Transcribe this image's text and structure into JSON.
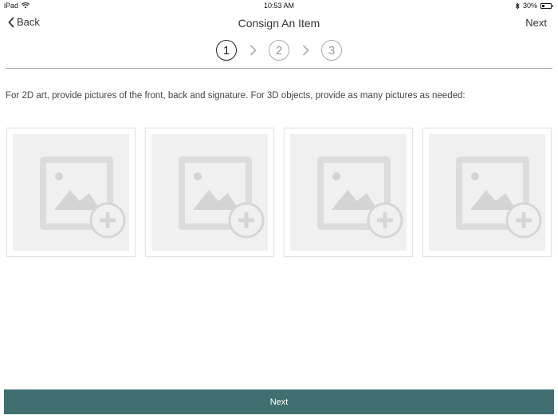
{
  "status_bar": {
    "device": "iPad",
    "time": "10:53 AM",
    "battery": "30%",
    "battery_level": 0.3
  },
  "nav": {
    "back_label": "Back",
    "title": "Consign An Item",
    "next_label": "Next"
  },
  "stepper": {
    "steps": [
      "1",
      "2",
      "3"
    ],
    "active_step": 1
  },
  "instructions": "For 2D art, provide pictures of the front, back and signature.  For 3D objects, provide as many pictures as needed:",
  "photo_slots": [
    {
      "icon": "add-photo-icon"
    },
    {
      "icon": "add-photo-icon"
    },
    {
      "icon": "add-photo-icon"
    },
    {
      "icon": "add-photo-icon"
    }
  ],
  "footer": {
    "next_label": "Next",
    "color": "#3f6f71"
  }
}
